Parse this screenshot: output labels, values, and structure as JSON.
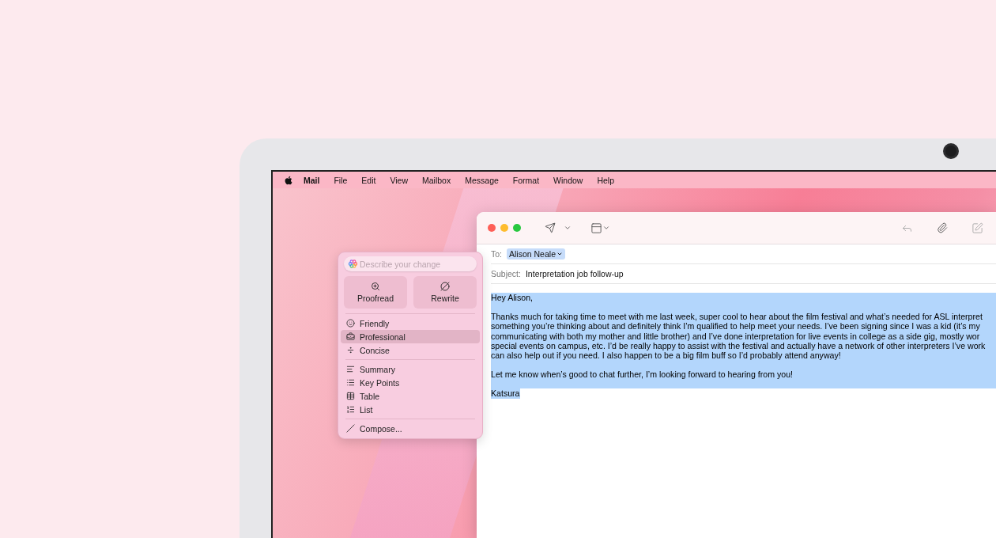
{
  "menubar": {
    "items": [
      {
        "label": "Mail",
        "kind": "app"
      },
      {
        "label": "File",
        "kind": "menu"
      },
      {
        "label": "Edit",
        "kind": "menu"
      },
      {
        "label": "View",
        "kind": "menu"
      },
      {
        "label": "Mailbox",
        "kind": "menu"
      },
      {
        "label": "Message",
        "kind": "menu"
      },
      {
        "label": "Format",
        "kind": "menu"
      },
      {
        "label": "Window",
        "kind": "menu"
      },
      {
        "label": "Help",
        "kind": "menu"
      }
    ]
  },
  "writing_tools": {
    "placeholder": "Describe your change",
    "actions": [
      {
        "label": "Proofread"
      },
      {
        "label": "Rewrite"
      }
    ],
    "groups": [
      [
        {
          "label": "Friendly",
          "selected": false
        },
        {
          "label": "Professional",
          "selected": true
        },
        {
          "label": "Concise",
          "selected": false
        }
      ],
      [
        {
          "label": "Summary",
          "selected": false
        },
        {
          "label": "Key Points",
          "selected": false
        },
        {
          "label": "Table",
          "selected": false
        },
        {
          "label": "List",
          "selected": false
        }
      ],
      [
        {
          "label": "Compose...",
          "selected": false
        }
      ]
    ]
  },
  "mail": {
    "to_label": "To:",
    "recipient": "Alison Neale",
    "subject_label": "Subject:",
    "subject": "Interpretation job follow-up",
    "body": {
      "selected": true,
      "paragraphs": [
        [
          "Hey Alison,"
        ],
        [
          "Thanks much for taking time to meet with me last week, super cool to hear about the film festival and what’s needed for ASL interpret",
          "something you’re thinking about and definitely think I’m qualified to help meet your needs. I’ve been signing since I was a kid (it’s my",
          "communicating with both my mother and little brother) and I’ve done interpretation for  live events in college as a side gig, mostly wor",
          "special events on campus, etc. I’d be really happy to assist with the festival and actually have a network of other interpreters I’ve work",
          "can also help out if you need. I also happen to be a big film buff so I’d probably attend anyway!"
        ],
        [
          "Let me know when’s good to chat further, I’m looking forward to hearing from you!"
        ],
        [
          "Katsura"
        ]
      ]
    }
  }
}
